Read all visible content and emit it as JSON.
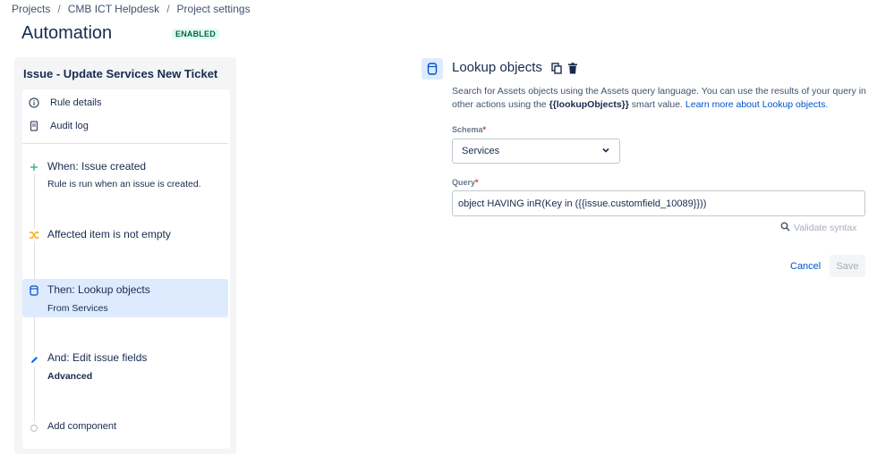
{
  "breadcrumb": [
    "Projects",
    "CMB ICT Helpdesk",
    "Project settings"
  ],
  "breadcrumb_separator": "/",
  "page": {
    "title": "Automation",
    "status_badge": "ENABLED"
  },
  "rule": {
    "title": "Issue - Update Services New Ticket",
    "nav": [
      {
        "label": "Rule details",
        "icon": "info-icon"
      },
      {
        "label": "Audit log",
        "icon": "audit-log-icon"
      }
    ],
    "steps": [
      {
        "title": "When: Issue created",
        "subtitle": "Rule is run when an issue is created.",
        "icon": "plus-icon",
        "color": "#36b37e"
      },
      {
        "title": "Affected item is not empty",
        "subtitle": "",
        "icon": "shuffle-icon",
        "color": "#ffab00"
      },
      {
        "title": "Then: Lookup objects",
        "subtitle": "From Services",
        "icon": "database-icon",
        "color": "#0052cc",
        "selected": true
      },
      {
        "title": "And: Edit issue fields",
        "subtitle": "Advanced",
        "icon": "pencil-icon",
        "color": "#0065ff"
      }
    ],
    "add_component": "Add component"
  },
  "action": {
    "title": "Lookup objects",
    "description_pre": "Search for Assets objects using the Assets query language. You can use the results of your query in other actions using the ",
    "smart_value": "{{lookupObjects}}",
    "description_mid": " smart value. ",
    "learn_more": "Learn more about Lookup objects.",
    "schema_label": "Schema",
    "schema_value": "Services",
    "query_label": "Query",
    "query_value": "object HAVING inR(Key in ({{issue.customfield_10089}}))",
    "required_mark": "*",
    "validate_label": "Validate syntax",
    "cancel_label": "Cancel",
    "save_label": "Save"
  },
  "colors": {
    "accent": "#0052cc",
    "selected_bg": "#deebff",
    "badge_bg": "#e3fcef",
    "badge_text": "#006644",
    "panel_bg": "#f4f5f7"
  }
}
